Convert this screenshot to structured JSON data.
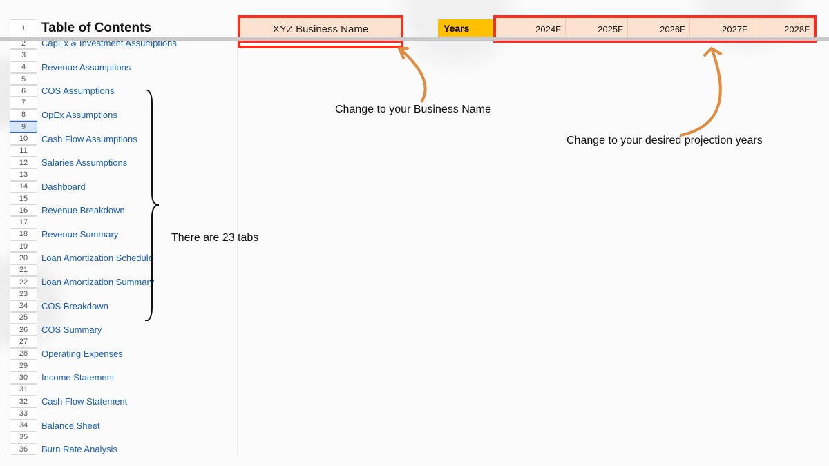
{
  "header": {
    "title": "Table of Contents",
    "business_name": "XYZ Business Name",
    "years_label": "Years",
    "years": [
      "2024F",
      "2025F",
      "2026F",
      "2027F",
      "2028F"
    ]
  },
  "toc": [
    {
      "row": "1",
      "label": ""
    },
    {
      "row": "2",
      "label": "CapEx & Investment Assumptions"
    },
    {
      "row": "3",
      "label": ""
    },
    {
      "row": "4",
      "label": "Revenue Assumptions"
    },
    {
      "row": "5",
      "label": ""
    },
    {
      "row": "6",
      "label": "COS Assumptions"
    },
    {
      "row": "7",
      "label": ""
    },
    {
      "row": "8",
      "label": "OpEx Assumptions"
    },
    {
      "row": "9",
      "label": ""
    },
    {
      "row": "10",
      "label": "Cash Flow Assumptions"
    },
    {
      "row": "11",
      "label": ""
    },
    {
      "row": "12",
      "label": "Salaries Assumptions"
    },
    {
      "row": "13",
      "label": ""
    },
    {
      "row": "14",
      "label": "Dashboard"
    },
    {
      "row": "15",
      "label": ""
    },
    {
      "row": "16",
      "label": "Revenue Breakdown"
    },
    {
      "row": "17",
      "label": ""
    },
    {
      "row": "18",
      "label": "Revenue Summary"
    },
    {
      "row": "19",
      "label": ""
    },
    {
      "row": "20",
      "label": "Loan Amortization Schedule"
    },
    {
      "row": "21",
      "label": ""
    },
    {
      "row": "22",
      "label": "Loan Amortization Summary"
    },
    {
      "row": "23",
      "label": ""
    },
    {
      "row": "24",
      "label": "COS Breakdown"
    },
    {
      "row": "25",
      "label": ""
    },
    {
      "row": "26",
      "label": "COS Summary"
    },
    {
      "row": "27",
      "label": ""
    },
    {
      "row": "28",
      "label": "Operating Expenses"
    },
    {
      "row": "29",
      "label": ""
    },
    {
      "row": "30",
      "label": "Income Statement"
    },
    {
      "row": "31",
      "label": ""
    },
    {
      "row": "32",
      "label": "Cash Flow Statement"
    },
    {
      "row": "33",
      "label": ""
    },
    {
      "row": "34",
      "label": "Balance Sheet"
    },
    {
      "row": "35",
      "label": ""
    },
    {
      "row": "36",
      "label": "Burn Rate Analysis"
    }
  ],
  "annotations": {
    "tabs": "There are 23 tabs",
    "business": "Change to your Business Name",
    "years": "Change to your desired projection years"
  },
  "selected_row": "9",
  "colors": {
    "highlight_border": "#ee3224",
    "peach": "#fde2cf",
    "yellow": "#ffc000",
    "arrow": "#e28a3d",
    "link": "#155cc6"
  }
}
